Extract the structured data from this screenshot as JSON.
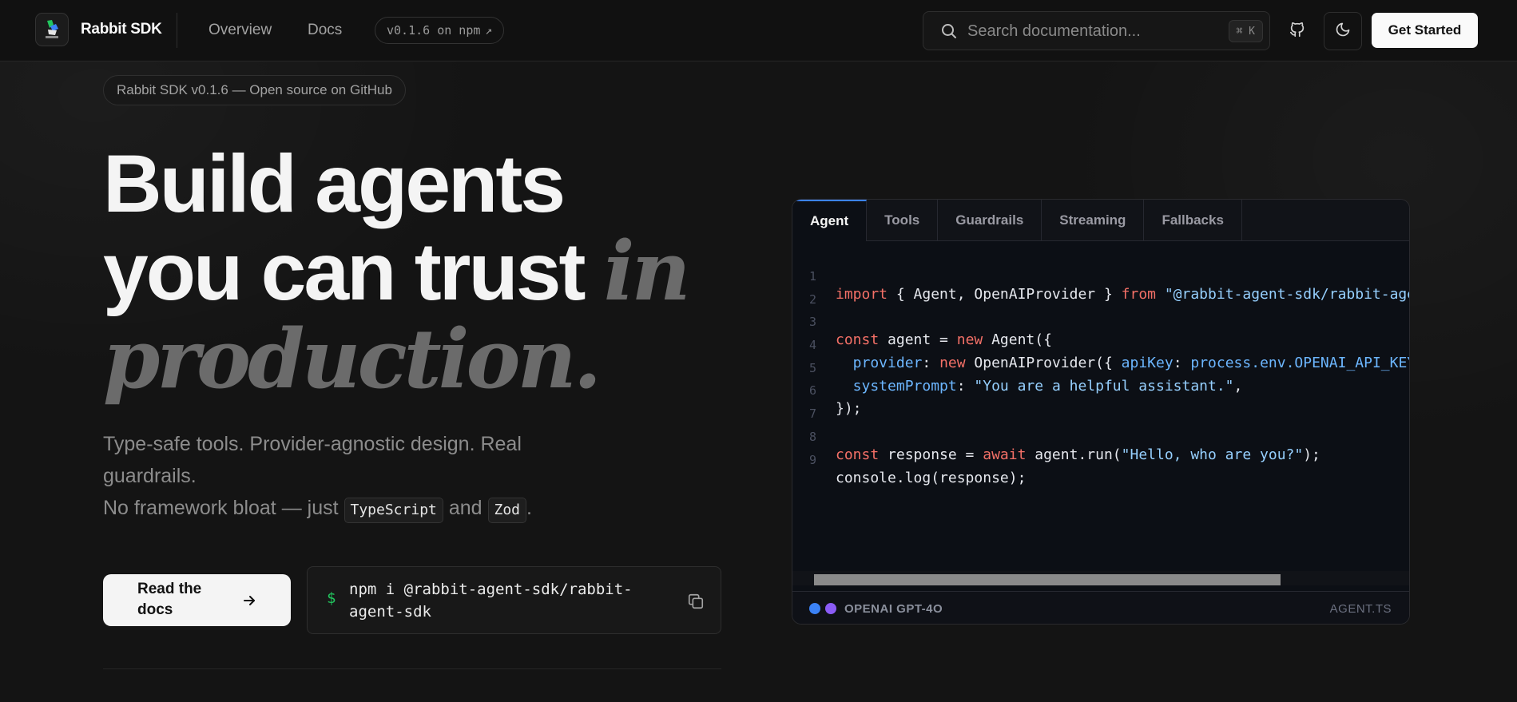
{
  "nav": {
    "brand": "Rabbit SDK",
    "logo_text": "RABBIT SDK",
    "links": [
      "Overview",
      "Docs"
    ],
    "version": "v0.1.6 on npm",
    "version_icon": "↗",
    "search_placeholder": "Search documentation...",
    "search_shortcut": "⌘ K",
    "cta": "Get Started"
  },
  "hero": {
    "announcement": "Rabbit SDK v0.1.6 — Open source on GitHub",
    "headline_line1": "Build agents",
    "headline_line2": "you can trust",
    "headline_italic1": "in",
    "headline_italic2": "production.",
    "sub_line1": "Type-safe tools. Provider-agnostic design. Real guardrails.",
    "sub_line2_prefix": "No framework bloat — just",
    "chip_typescript": "TypeScript",
    "sub_and": "and",
    "chip_zod": "Zod",
    "sub_end": ".",
    "read_docs": "Read the docs",
    "npm_prompt": "$",
    "npm_command": "npm i @rabbit-agent-sdk/rabbit-agent-sdk"
  },
  "code_panel": {
    "tabs": [
      "Agent",
      "Tools",
      "Guardrails",
      "Streaming",
      "Fallbacks"
    ],
    "active_tab": "Agent",
    "line_numbers": [
      "1",
      "2",
      "3",
      "4",
      "5",
      "6",
      "7",
      "8",
      "9"
    ],
    "code": {
      "l1_import": "import",
      "l1_names": " { Agent, OpenAIProvider } ",
      "l1_from": "from",
      "l1_module": " \"@rabbit-agent-sdk/rabbit-agent-sdk\";",
      "l3_const": "const",
      "l3_rest": " agent = ",
      "l3_new": "new",
      "l3_call": " Agent({",
      "l4_key": "  provider",
      "l4_colon": ": ",
      "l4_new": "new",
      "l4_call": " OpenAIProvider({ ",
      "l4_apikey": "apiKey",
      "l4_colon2": ": ",
      "l4_env": "process.env.OPENAI_API_KEY }),",
      "l5_key": "  systemPrompt",
      "l5_colon": ": ",
      "l5_str": "\"You are a helpful assistant.\"",
      "l5_end": ",",
      "l6": "});",
      "l8_const": "const",
      "l8_rest": " response = ",
      "l8_await": "await",
      "l8_call": " agent.run(",
      "l8_str": "\"Hello, who are you?\"",
      "l8_end": ");",
      "l9": "console.log(response);"
    },
    "scroll_position": 0.0,
    "footer_model": "OPENAI GPT-4O",
    "footer_file": "AGENT.TS"
  },
  "colors": {
    "accent_blue": "#3b82f6",
    "accent_purple": "#8b5cf6",
    "prompt_green": "#22c55e"
  }
}
